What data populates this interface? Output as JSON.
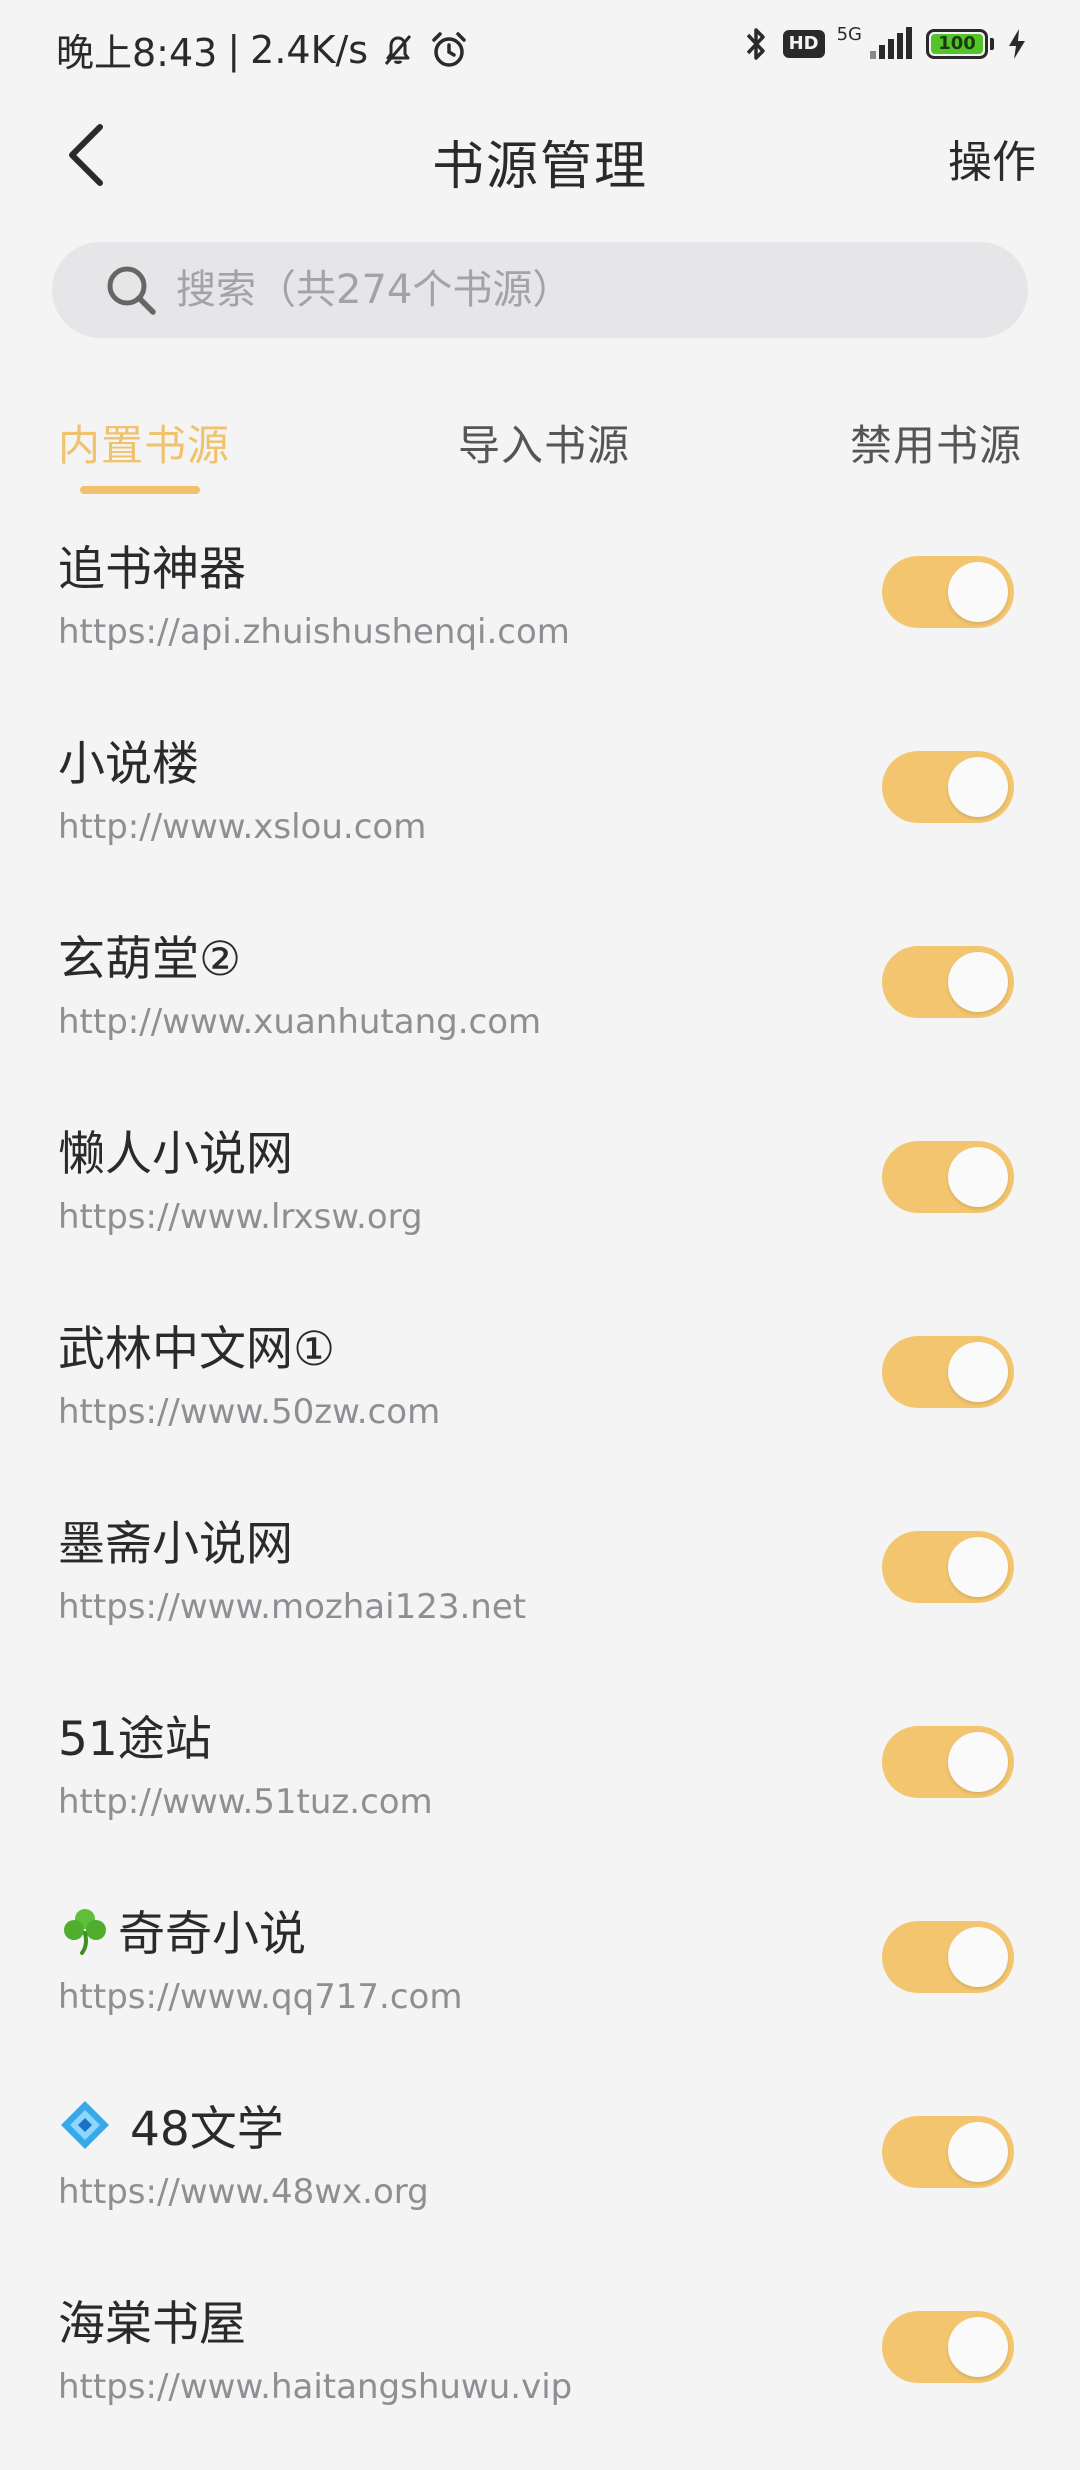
{
  "status_bar": {
    "time": "晚上8:43",
    "separator": "|",
    "speed": "2.4K/s",
    "network": "5G",
    "hd": "HD",
    "battery_level": "100",
    "battery_percent": 100
  },
  "header": {
    "title": "书源管理",
    "action_label": "操作"
  },
  "search": {
    "placeholder": "搜索（共274个书源）"
  },
  "tabs": [
    {
      "label": "内置书源",
      "active": true
    },
    {
      "label": "导入书源",
      "active": false
    },
    {
      "label": "禁用书源",
      "active": false
    }
  ],
  "sources": [
    {
      "name": "追书神器",
      "url": "https://api.zhuishushenqi.com",
      "enabled": true
    },
    {
      "name": "小说楼",
      "url": "http://www.xslou.com",
      "enabled": true
    },
    {
      "name": "玄葫堂②",
      "url": "http://www.xuanhutang.com",
      "enabled": true
    },
    {
      "name": "懒人小说网",
      "url": "https://www.lrxsw.org",
      "enabled": true
    },
    {
      "name": "武林中文网①",
      "url": "https://www.50zw.com",
      "enabled": true
    },
    {
      "name": "墨斋小说网",
      "url": "https://www.mozhai123.net",
      "enabled": true
    },
    {
      "name": "51途站",
      "url": "http://www.51tuz.com",
      "enabled": true
    },
    {
      "name": "奇奇小说",
      "url": "https://www.qq717.com",
      "enabled": true,
      "icon": "clover-icon"
    },
    {
      "name": "48文学",
      "url": "https://www.48wx.org",
      "enabled": true,
      "icon": "blue-diamond-icon"
    },
    {
      "name": "海棠书屋",
      "url": "https://www.haitangshuwu.vip",
      "enabled": true
    }
  ],
  "colors": {
    "accent": "#f1c26e",
    "toggle_on": "#f3c56e",
    "background": "#f4f4f4",
    "url_text": "#8e8e93"
  }
}
